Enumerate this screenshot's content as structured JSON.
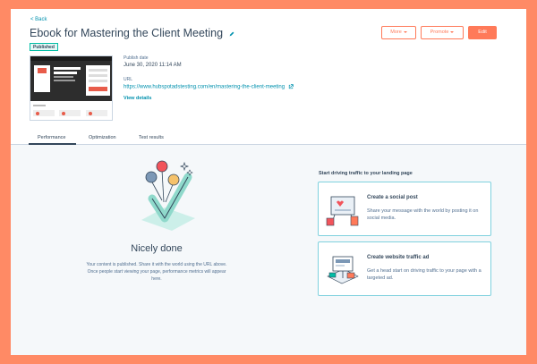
{
  "header": {
    "back_label": "< Back",
    "title": "Ebook for Mastering the Client Meeting",
    "status_badge": "Published",
    "publish_date_label": "Publish date",
    "publish_date_value": "June 30, 2020 11:14 AM",
    "url_label": "URL",
    "url_value": "https://www.hubspotadstesting.com/en/mastering-the-client-meeting",
    "view_details": "View details",
    "more_label": "More",
    "promote_label": "Promote",
    "edit_label": "Edit"
  },
  "tabs": [
    {
      "label": "Performance",
      "active": true
    },
    {
      "label": "Optimization",
      "active": false
    },
    {
      "label": "Test results",
      "active": false
    }
  ],
  "main": {
    "done_title": "Nicely done",
    "done_text": "Your content is published. Share it with the world using the URL above. Once people start viewing your page, performance metrics will appear here."
  },
  "side": {
    "heading": "Start driving traffic to your landing page",
    "cards": [
      {
        "title": "Create a social post",
        "desc": "Share your message with the world by posting it on social media.",
        "icon": "social-post-illustration"
      },
      {
        "title": "Create website traffic ad",
        "desc": "Get a head start on driving traffic to your page with a targeted ad.",
        "icon": "traffic-ad-illustration"
      }
    ]
  },
  "colors": {
    "accent": "#ff7a59",
    "link": "#0091ae",
    "text": "#33475b",
    "card_border": "#7fd1de",
    "background": "#f5f8fa"
  }
}
